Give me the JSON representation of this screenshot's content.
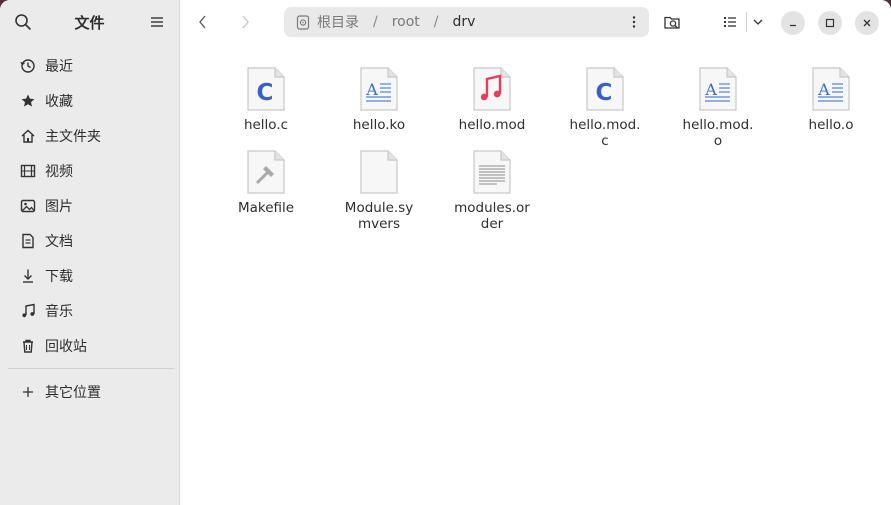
{
  "sidebar": {
    "title": "文件",
    "items": [
      {
        "label": "最近",
        "icon": "clock-icon"
      },
      {
        "label": "收藏",
        "icon": "star-icon"
      },
      {
        "label": "主文件夹",
        "icon": "home-icon"
      },
      {
        "label": "视频",
        "icon": "film-icon"
      },
      {
        "label": "图片",
        "icon": "image-icon"
      },
      {
        "label": "文档",
        "icon": "document-icon"
      },
      {
        "label": "下载",
        "icon": "download-icon"
      },
      {
        "label": "音乐",
        "icon": "music-icon"
      },
      {
        "label": "回收站",
        "icon": "trash-icon"
      }
    ],
    "other_locations": "其它位置"
  },
  "pathbar": {
    "root": "根目录",
    "separator": "/",
    "segments": [
      "root",
      "drv"
    ]
  },
  "files": [
    {
      "name": "hello.c",
      "type": "c-source"
    },
    {
      "name": "hello.ko",
      "type": "object"
    },
    {
      "name": "hello.mod",
      "type": "audio"
    },
    {
      "name": "hello.mod.c",
      "type": "c-source"
    },
    {
      "name": "hello.mod.o",
      "type": "object"
    },
    {
      "name": "hello.o",
      "type": "object"
    },
    {
      "name": "Makefile",
      "type": "makefile"
    },
    {
      "name": "Module.symvers",
      "type": "blank"
    },
    {
      "name": "modules.order",
      "type": "text"
    }
  ],
  "colors": {
    "accent_c": "#3a5fc8",
    "music": "#e0405a",
    "text_lines": "#4f86d6"
  }
}
